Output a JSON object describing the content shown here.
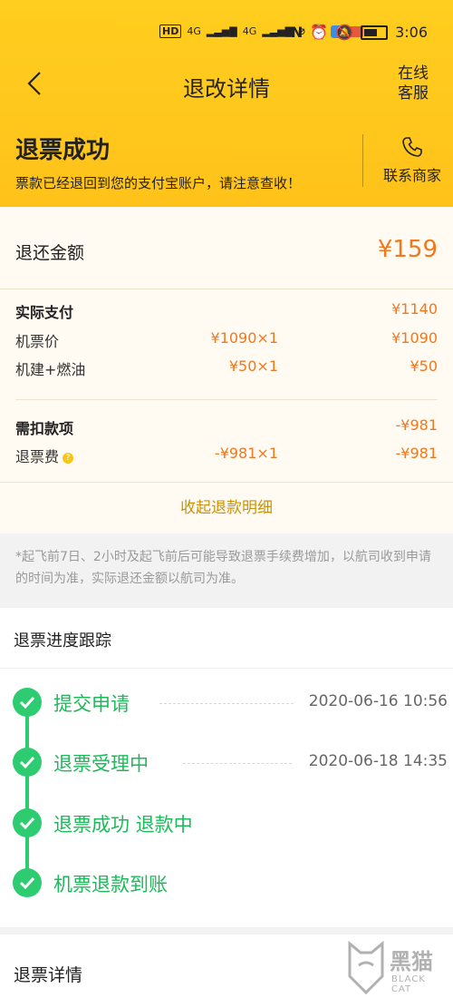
{
  "status_bar": {
    "left_icons": [
      "HD",
      "4G",
      "4G"
    ],
    "time": "3:06"
  },
  "nav": {
    "title": "退改详情",
    "service_line1": "在线",
    "service_line2": "客服"
  },
  "refund": {
    "title": "退票成功",
    "subtitle": "票款已经退回到您的支付宝账户，请注意查收！",
    "contact_label": "联系商家"
  },
  "amount": {
    "label": "退还金额",
    "value": "¥159"
  },
  "payment": {
    "header": {
      "label": "实际支付",
      "total": "¥1140"
    },
    "rows": [
      {
        "label": "机票价",
        "unit": "¥1090×1",
        "total": "¥1090"
      },
      {
        "label": "机建+燃油",
        "unit": "¥50×1",
        "total": "¥50"
      }
    ]
  },
  "deduction": {
    "header": {
      "label": "需扣款项",
      "total": "-¥981"
    },
    "rows": [
      {
        "label": "退票费",
        "unit": "-¥981×1",
        "total": "-¥981"
      }
    ]
  },
  "collapse_label": "收起退款明细",
  "notice": "*起飞前7日、2小时及起飞前后可能导致退票手续费增加，以航司收到申请的时间为准，实际退还金额以航司为准。",
  "progress": {
    "title": "退票进度跟踪",
    "steps": [
      {
        "name": "提交申请",
        "time": "2020-06-16 10:56"
      },
      {
        "name": "退票受理中",
        "time": "2020-06-18 14:35"
      },
      {
        "name": "退票成功 退款中",
        "time": ""
      },
      {
        "name": "机票退款到账",
        "time": ""
      }
    ],
    "color": "#2ecc71"
  },
  "details": {
    "title": "退票详情"
  },
  "watermark": {
    "text": "黑猫",
    "sub": "BLACK CAT"
  },
  "colors": {
    "header_yellow": "#ffc61c",
    "amount_orange": "#f0781e",
    "link_gold": "#c9920a"
  }
}
